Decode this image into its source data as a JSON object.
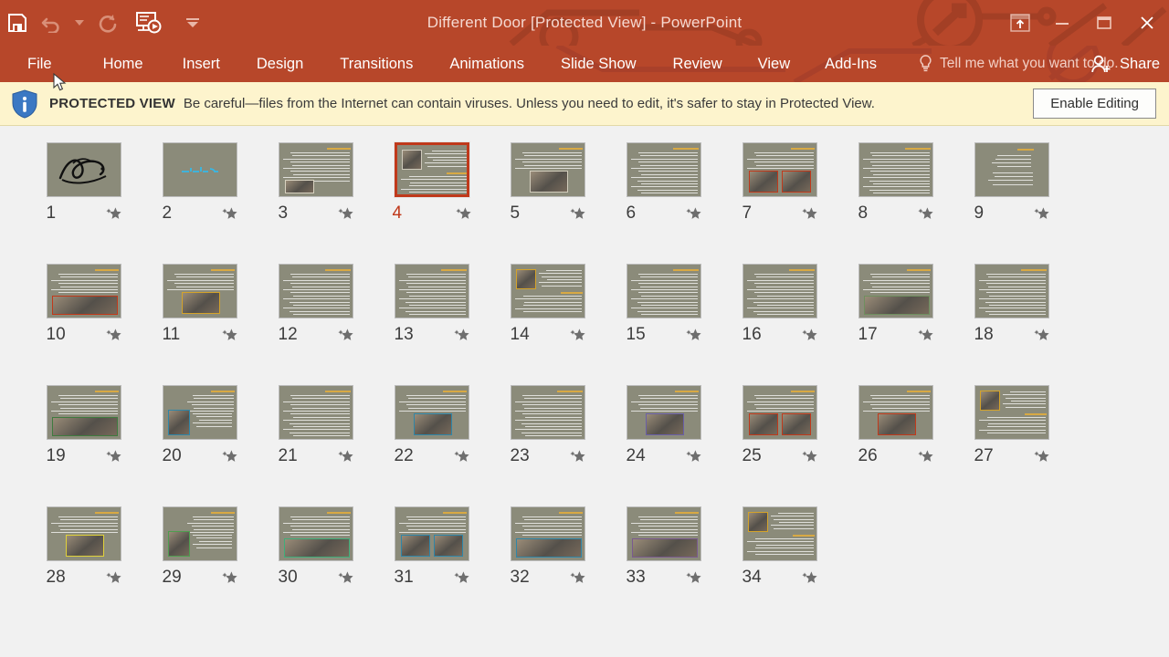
{
  "window": {
    "title": "Different Door [Protected View] - PowerPoint",
    "accent_color": "#b7472a",
    "quick_access": [
      {
        "name": "save-icon",
        "label": "Save"
      },
      {
        "name": "undo-icon",
        "label": "Undo"
      },
      {
        "name": "undo-dropdown-icon",
        "label": "Undo options"
      },
      {
        "name": "redo-icon",
        "label": "Redo"
      },
      {
        "name": "start-slideshow-icon",
        "label": "Start From Beginning"
      },
      {
        "name": "customize-qat-icon",
        "label": "Customize Quick Access Toolbar"
      }
    ],
    "controls": [
      {
        "name": "ribbon-display-options-icon",
        "label": "Ribbon Display Options"
      },
      {
        "name": "minimize-icon",
        "label": "Minimize"
      },
      {
        "name": "restore-icon",
        "label": "Restore Down"
      },
      {
        "name": "close-icon",
        "label": "Close"
      }
    ]
  },
  "menu": {
    "items": [
      {
        "label": "File"
      },
      {
        "label": "Home"
      },
      {
        "label": "Insert"
      },
      {
        "label": "Design"
      },
      {
        "label": "Transitions"
      },
      {
        "label": "Animations"
      },
      {
        "label": "Slide Show"
      },
      {
        "label": "Review"
      },
      {
        "label": "View"
      },
      {
        "label": "Add-Ins"
      }
    ],
    "tell_me": "Tell me what you want to do.",
    "share": "Share"
  },
  "protected_view": {
    "badge": "PROTECTED VIEW",
    "message": "Be careful—files from the Internet can contain viruses. Unless you need to edit, it's safer to stay in Protected View.",
    "button": "Enable Editing",
    "background": "#fdf4cd"
  },
  "slides": {
    "selected": 4,
    "count": 34,
    "background": "#8b8b7a",
    "items": [
      {
        "number": "1",
        "kind": "calligraphy",
        "animated": true
      },
      {
        "number": "2",
        "kind": "title",
        "animated": true
      },
      {
        "number": "3",
        "kind": "text-pic-bl",
        "animated": true
      },
      {
        "number": "4",
        "kind": "text-pic-tl",
        "animated": true,
        "selected": true
      },
      {
        "number": "5",
        "kind": "text-pic-mid",
        "animated": true
      },
      {
        "number": "6",
        "kind": "text",
        "animated": true
      },
      {
        "number": "7",
        "kind": "text-2pic",
        "animated": true
      },
      {
        "number": "8",
        "kind": "text",
        "animated": true
      },
      {
        "number": "9",
        "kind": "text-sparse",
        "animated": true
      },
      {
        "number": "10",
        "kind": "text-wide-pic",
        "animated": true
      },
      {
        "number": "11",
        "kind": "text-pic-mid",
        "animated": true
      },
      {
        "number": "12",
        "kind": "text",
        "animated": true
      },
      {
        "number": "13",
        "kind": "text",
        "animated": true
      },
      {
        "number": "14",
        "kind": "text-pic-tl",
        "animated": true
      },
      {
        "number": "15",
        "kind": "text",
        "animated": true
      },
      {
        "number": "16",
        "kind": "text",
        "animated": true
      },
      {
        "number": "17",
        "kind": "text-wide-pic",
        "animated": true
      },
      {
        "number": "18",
        "kind": "text",
        "animated": true
      },
      {
        "number": "19",
        "kind": "text-wide-pic",
        "animated": true
      },
      {
        "number": "20",
        "kind": "text-pic-left",
        "animated": true
      },
      {
        "number": "21",
        "kind": "text",
        "animated": true
      },
      {
        "number": "22",
        "kind": "text-pic-mid",
        "animated": true
      },
      {
        "number": "23",
        "kind": "text",
        "animated": true
      },
      {
        "number": "24",
        "kind": "text-pic-mid",
        "animated": true
      },
      {
        "number": "25",
        "kind": "text-2pic",
        "animated": true
      },
      {
        "number": "26",
        "kind": "text-pic-mid",
        "animated": true
      },
      {
        "number": "27",
        "kind": "text-pic-tl",
        "animated": true
      },
      {
        "number": "28",
        "kind": "text-pic-mid",
        "animated": true
      },
      {
        "number": "29",
        "kind": "text-pic-left",
        "animated": true
      },
      {
        "number": "30",
        "kind": "text-wide-pic",
        "animated": true
      },
      {
        "number": "31",
        "kind": "text-2pic",
        "animated": true
      },
      {
        "number": "32",
        "kind": "text-wide-pic",
        "animated": true
      },
      {
        "number": "33",
        "kind": "text-wide-pic",
        "animated": true
      },
      {
        "number": "34",
        "kind": "text-pic-tl",
        "animated": true
      }
    ]
  }
}
